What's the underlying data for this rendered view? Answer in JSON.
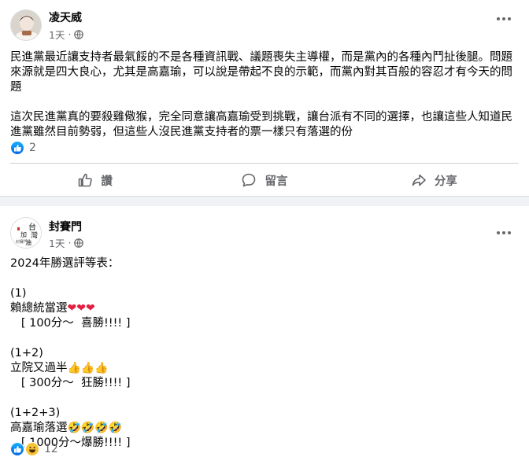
{
  "post1": {
    "author": "凌天威",
    "time": "1天",
    "privacy_icon": "globe-icon",
    "text": "民進黨最近讓支持者最氣餒的不是各種資訊戰、議題喪失主導權，而是黨內的各種內鬥扯後腿。問題來源就是四大良心，尤其是高嘉瑜，可以說是帶起不良的示範，而黨內對其百般的容忍才有今天的問題\n\n這次民進黨真的要殺雞儆猴，完全同意讓高嘉瑜受到挑戰，讓台派有不同的選擇，也讓這些人知道民進黨雖然目前勢弱，但這些人沒民進黨支持者的票一樣只有落選的份",
    "reactions": {
      "icons": [
        "like-icon"
      ],
      "count": "2"
    },
    "actions": {
      "like": "讚",
      "comment": "留言",
      "share": "分享"
    }
  },
  "post2": {
    "author": "封賽門",
    "time": "1天",
    "privacy_icon": "globe-icon",
    "avatar_text": "台灣加油",
    "lines": [
      {
        "text": "2024年勝選評等表："
      },
      {
        "text": ""
      },
      {
        "text": "(1)"
      },
      {
        "text": "賴總統當選",
        "emoji": "❤❤❤",
        "emoji_color": "#e41e3f"
      },
      {
        "text": "   [ 100分～  喜勝!!!! ]"
      },
      {
        "text": ""
      },
      {
        "text": "(1+2)"
      },
      {
        "text": "立院又過半",
        "emoji": "👍👍👍",
        "emoji_color": "#f5b21b"
      },
      {
        "text": "   [ 300分～  狂勝!!!! ]"
      },
      {
        "text": ""
      },
      {
        "text": "(1+2+3)"
      },
      {
        "text": "高嘉瑜落選",
        "emoji": "🤣🤣🤣🤣",
        "emoji_color": "#f5b21b"
      },
      {
        "text": "   [ 1000分～爆勝!!!! ]"
      }
    ],
    "reactions": {
      "icons": [
        "like-icon",
        "haha-icon"
      ],
      "count": "12"
    }
  }
}
